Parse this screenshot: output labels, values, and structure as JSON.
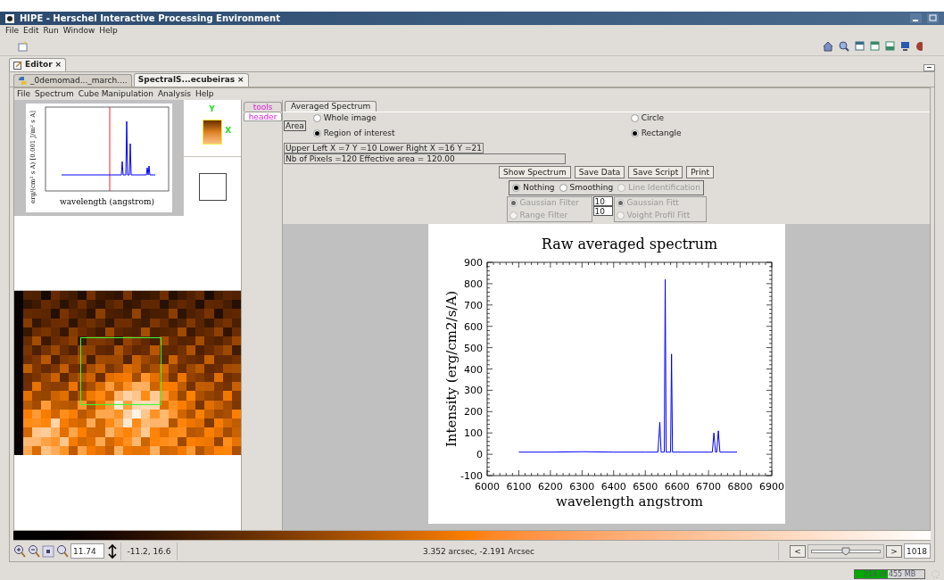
{
  "window": {
    "title": "HIPE - Herschel Interactive Processing Environment"
  },
  "menu": [
    "File",
    "Edit",
    "Run",
    "Window",
    "Help"
  ],
  "editor_tabs": [
    {
      "label": "Editor",
      "close": "×",
      "selected": true
    }
  ],
  "document_tabs": [
    {
      "label": "_0demomad..._march....",
      "kind": "python",
      "selected": false
    },
    {
      "label": "SpectralS...ecubeiras",
      "kind": "plain",
      "close": "×",
      "selected": true
    }
  ],
  "document_menu": [
    "File",
    "Spectrum",
    "Cube Manipulation",
    "Analysis",
    "Help"
  ],
  "preview_plot": {
    "xlabel": "wavelength (angstrom)",
    "ylabel": "erg/(cm² s A) [0.001 J/m² s A]"
  },
  "thumbnail": {
    "y_label": "Y",
    "x_label": "X"
  },
  "side_tabs": [
    {
      "label": "tools",
      "selected": false
    },
    {
      "label": "header",
      "selected": true
    }
  ],
  "panel_tabs": [
    {
      "label": "Averaged Spectrum",
      "selected": true
    }
  ],
  "area": {
    "label": "Area",
    "options": [
      {
        "label": "Whole image",
        "selected": false
      },
      {
        "label": "Region of interest",
        "selected": true
      }
    ],
    "shapes": [
      {
        "label": "Circle",
        "selected": false
      },
      {
        "label": "Rectangle",
        "selected": true
      }
    ]
  },
  "info_lines": [
    "Upper Left X =7 Y =10 Lower Right  X =16 Y =21",
    "Nb of Pixels =120 Effective area =    120.00"
  ],
  "buttons": [
    "Show Spectrum",
    "Save Data",
    "Save Script",
    "Print"
  ],
  "processing": [
    {
      "label": "Nothing",
      "selected": true,
      "disabled": false
    },
    {
      "label": "Smoothing",
      "selected": false,
      "disabled": false
    },
    {
      "label": "Line Identification",
      "selected": false,
      "disabled": true
    }
  ],
  "filters": [
    {
      "label": "Gaussian Filter",
      "selected": true,
      "disabled": true
    },
    {
      "label": "Range Filter",
      "selected": false,
      "disabled": true
    }
  ],
  "filter_values": [
    "10",
    "10"
  ],
  "fits": [
    {
      "label": "Gaussian Fitt",
      "selected": true,
      "disabled": true
    },
    {
      "label": "Voight Profil Fitt",
      "selected": false,
      "disabled": true
    }
  ],
  "chart_data": {
    "type": "line",
    "title": "Raw averaged spectrum",
    "xlabel": "wavelength angstrom",
    "ylabel": "Intensity (erg/cm2/s/A)",
    "x": [
      6100,
      6200,
      6300,
      6400,
      6500,
      6540,
      6546,
      6550,
      6556,
      6560,
      6563,
      6566,
      6572,
      6580,
      6583,
      6586,
      6592,
      6700,
      6712,
      6717,
      6722,
      6726,
      6731,
      6736,
      6790
    ],
    "series": [
      {
        "color": "#0000ff",
        "values": [
          10,
          10,
          12,
          10,
          10,
          10,
          150,
          10,
          10,
          10,
          820,
          10,
          10,
          10,
          470,
          10,
          10,
          10,
          10,
          100,
          10,
          10,
          110,
          10,
          10
        ]
      }
    ],
    "xlim": [
      6000,
      6900
    ],
    "ylim": [
      -100,
      900
    ],
    "xticks": [
      6000,
      6100,
      6200,
      6300,
      6400,
      6500,
      6600,
      6700,
      6800,
      6900
    ],
    "yticks": [
      -100,
      0,
      100,
      200,
      300,
      400,
      500,
      600,
      700,
      800,
      900
    ]
  },
  "bottom_bar": {
    "zoom": "11.74",
    "pixel": "-11.2, 16.6",
    "coordinates": "3.352 arcsec, -2.191 Arcsec",
    "prev": "<",
    "next": ">",
    "slider": {
      "level": 0.5
    },
    "frame": "1018"
  },
  "memory": {
    "text": "214 of 455 MB",
    "level": 0.47
  }
}
